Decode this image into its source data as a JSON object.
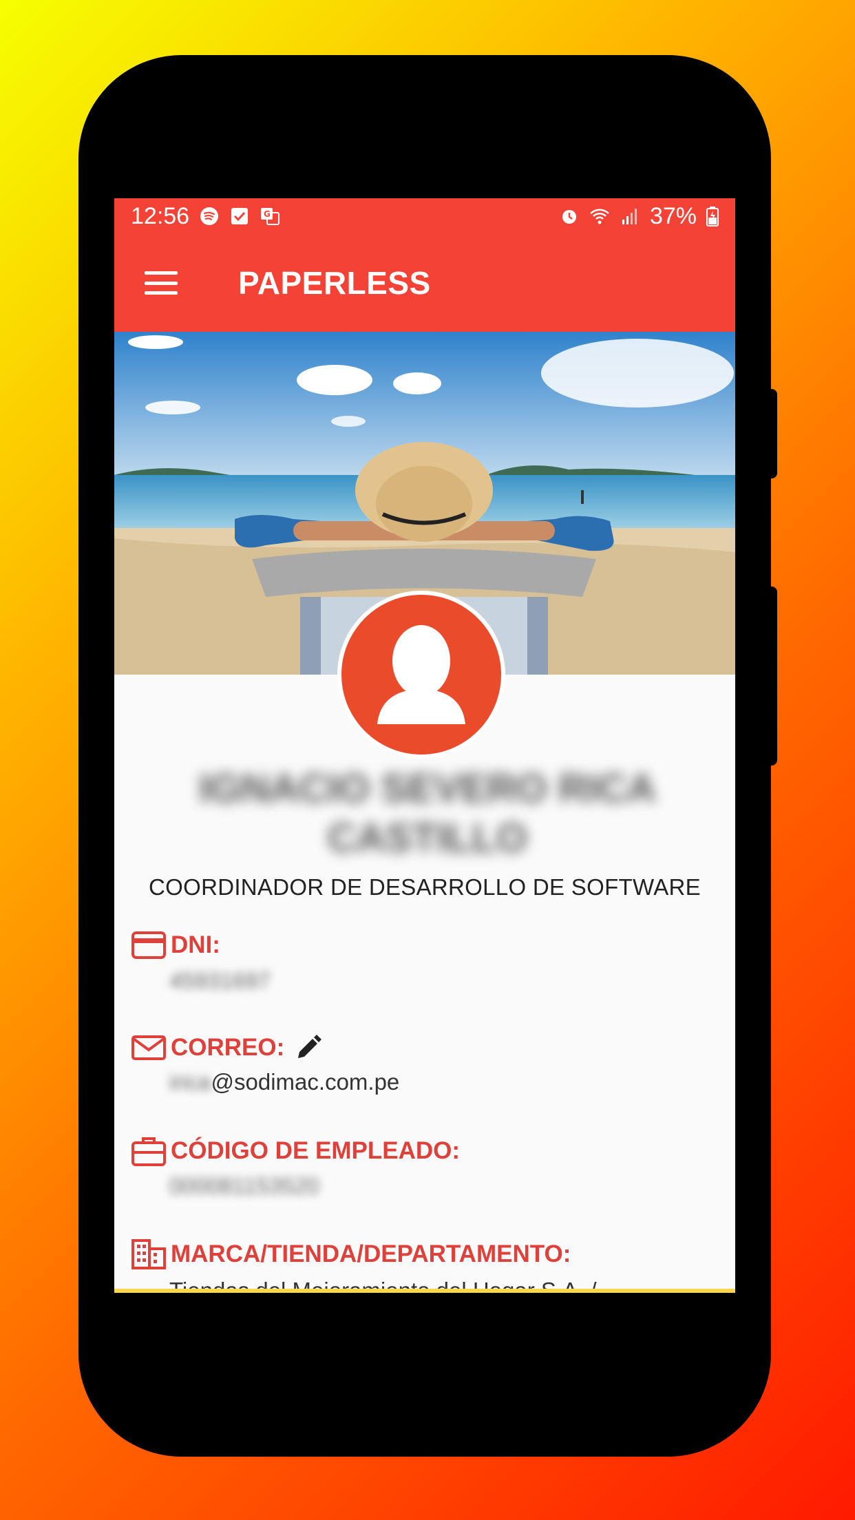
{
  "status_bar": {
    "time": "12:56",
    "battery": "37%",
    "left_icons": [
      "spotify-icon",
      "checkbox-icon",
      "translate-icon"
    ],
    "right_icons": [
      "alarm-icon",
      "wifi-icon",
      "signal-icon",
      "battery-charging-icon"
    ]
  },
  "app_bar": {
    "title": "PAPERLESS",
    "menu_icon": "menu-icon"
  },
  "profile": {
    "name": "IGNACIO SEVERO RICA CASTILLO",
    "job_title": "COORDINADOR DE DESARROLLO DE SOFTWARE"
  },
  "fields": {
    "dni": {
      "label": "DNI:",
      "value": "45931697",
      "icon": "card-icon"
    },
    "correo": {
      "label": "CORREO:",
      "value_prefix": "irica",
      "value_domain": "@sodimac.com.pe",
      "icon": "mail-icon",
      "edit_icon": "pencil-icon"
    },
    "codigo": {
      "label": "CÓDIGO DE EMPLEADO:",
      "value": "000081153520",
      "icon": "briefcase-icon"
    },
    "marca": {
      "label": "MARCA/TIENDA/DEPARTAMENTO:",
      "value": "Tiendas del Mejoramiento del Hogar S.A. /",
      "icon": "building-icon"
    }
  },
  "colors": {
    "primary": "#f44336",
    "accent_label": "#e0403a",
    "avatar_bg": "#e94b2b"
  }
}
